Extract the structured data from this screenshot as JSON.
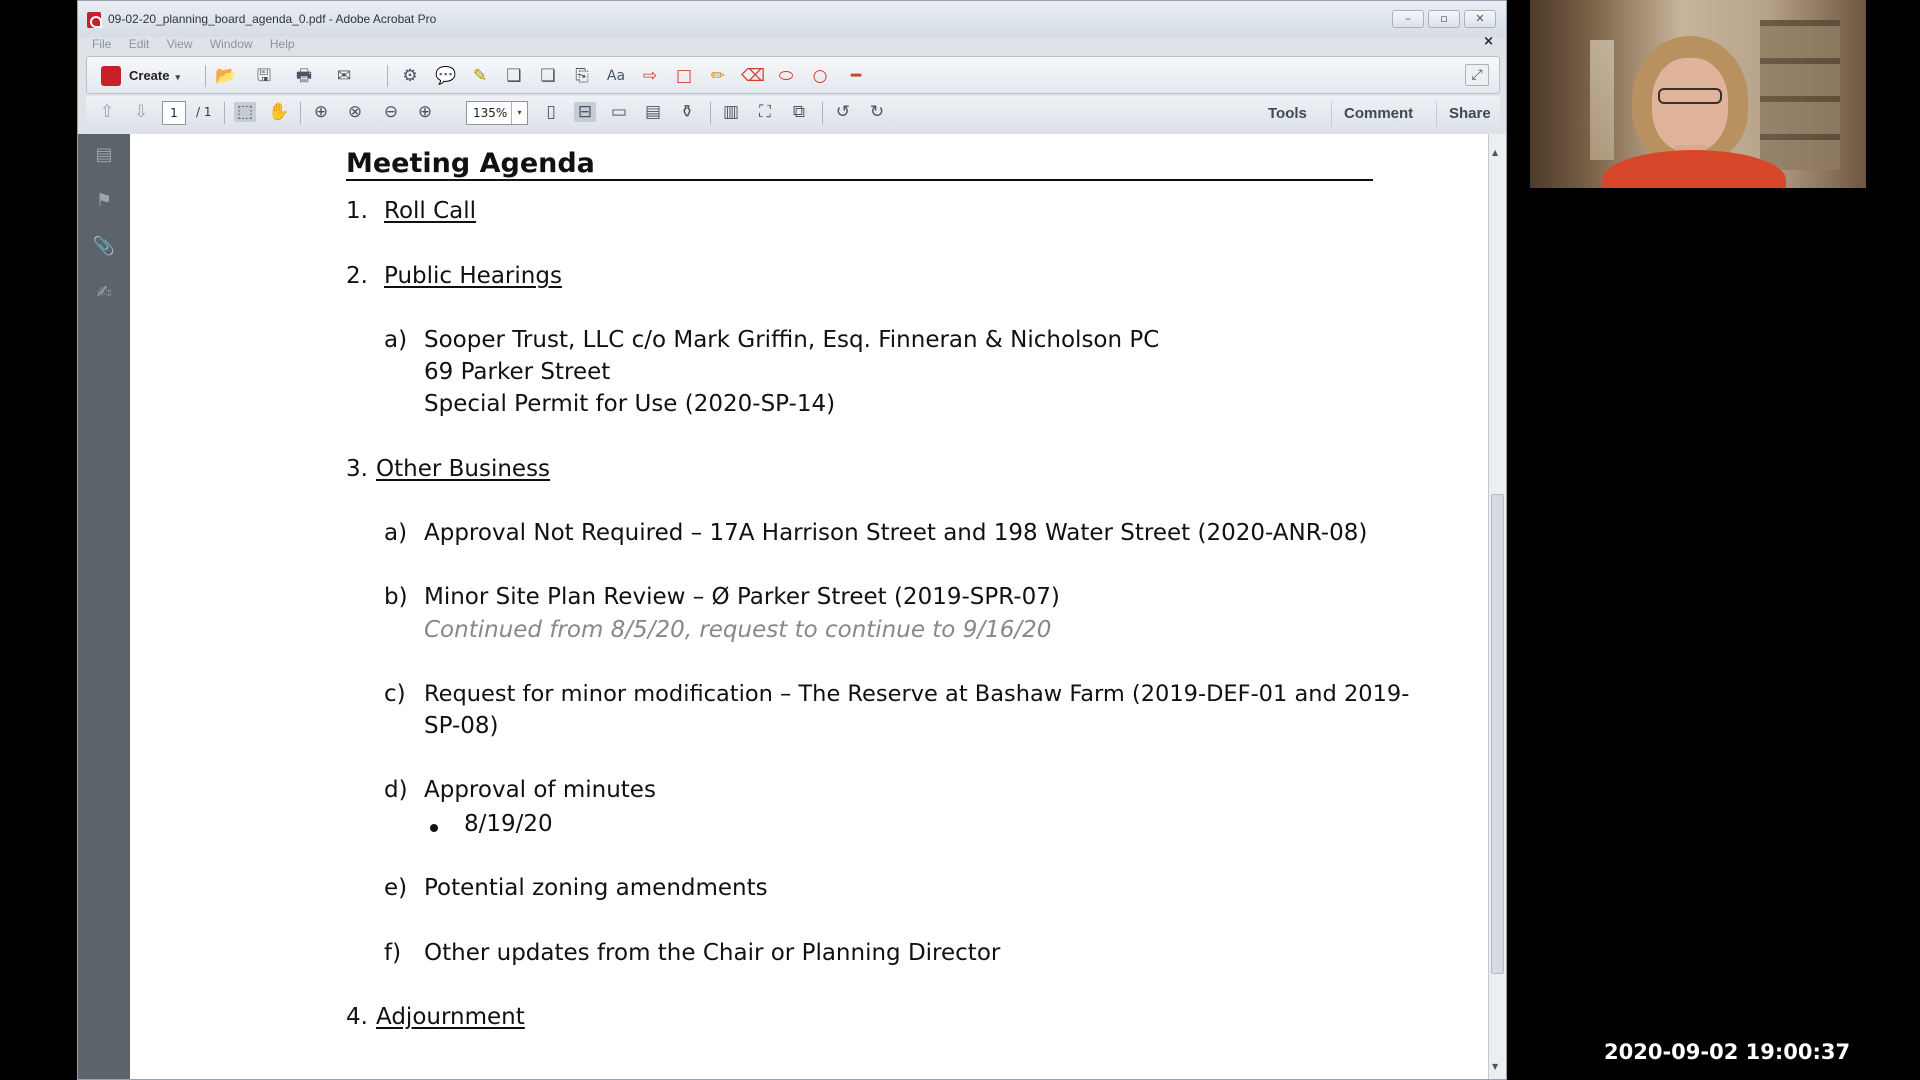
{
  "window": {
    "title": "09-02-20_planning_board_agenda_0.pdf - Adobe Acrobat Pro",
    "min_glyph": "–",
    "max_glyph": "▫",
    "close_glyph": "✕"
  },
  "menu": [
    "File",
    "Edit",
    "View",
    "Window",
    "Help"
  ],
  "doc_close": "×",
  "toolbar": {
    "create_label": "Create",
    "create_caret": "▾",
    "page_current": "1",
    "page_total": "/ 1",
    "zoom": "135%",
    "zoom_caret": "▾",
    "expand_glyph": "⤢"
  },
  "panes": {
    "tools": "Tools",
    "comment": "Comment",
    "share": "Share"
  },
  "icons": {
    "open": "📂",
    "save": "🖫",
    "print": "🖶",
    "email": "✉",
    "settings": "⚙",
    "comment": "💬",
    "highlight": "✎",
    "stamp": "❑",
    "attach": "❏",
    "export": "⎘",
    "text": "Aa",
    "arrow": "⇨",
    "rect": "□",
    "pencil": "✏",
    "eraser": "⌫",
    "oval": "⬭",
    "circle": "○",
    "line": "━",
    "up": "⇧",
    "down": "⇩",
    "select": "⬚",
    "hand": "✋",
    "zoom_marquee": "⊕",
    "zoom_dynamic": "⊗",
    "zoom_out": "⊖",
    "zoom_in": "⊕",
    "fit_page": "▯",
    "fit_width": "⊟",
    "single": "▭",
    "spread": "▤",
    "stamp2": "⚱",
    "read": "▥",
    "full": "⛶",
    "split": "⧉",
    "rotate_ccw": "↺",
    "rotate_cw": "↻",
    "pages": "▤",
    "bookmarks": "⚑",
    "attachments": "📎",
    "signatures": "✍",
    "scroll_up": "▲",
    "scroll_down": "▼"
  },
  "agenda": {
    "heading": "Meeting Agenda",
    "items": [
      {
        "num": "1.",
        "title": "Roll Call"
      },
      {
        "num": "2.",
        "title": "Public Hearings"
      },
      {
        "num": "3.",
        "title": "Other Business"
      },
      {
        "num": "4.",
        "title": "Adjournment"
      }
    ],
    "hearing_a": {
      "letter": "a)",
      "line1": "Sooper Trust, LLC c/o Mark Griffin, Esq. Finneran & Nicholson PC",
      "line2": "69 Parker Street",
      "line3": "Special Permit for Use (2020-SP-14)"
    },
    "business": [
      {
        "letter": "a)",
        "line1": "Approval Not Required – 17A Harrison Street and 198 Water Street (2020-ANR-08)"
      },
      {
        "letter": "b)",
        "line1": "Minor Site Plan Review – Ø Parker Street (2019-SPR-07)",
        "note": "Continued from 8/5/20, request to continue to 9/16/20"
      },
      {
        "letter": "c)",
        "line1": "Request for minor modification – The Reserve at Bashaw Farm (2019-DEF-01 and 2019-",
        "line2": "SP-08)"
      },
      {
        "letter": "d)",
        "line1": "Approval of minutes",
        "bullet": "8/19/20"
      },
      {
        "letter": "e)",
        "line1": "Potential zoning amendments"
      },
      {
        "letter": "f)",
        "line1": "Other updates from the Chair or Planning Director"
      }
    ]
  },
  "timestamp": "2020-09-02  19:00:37"
}
